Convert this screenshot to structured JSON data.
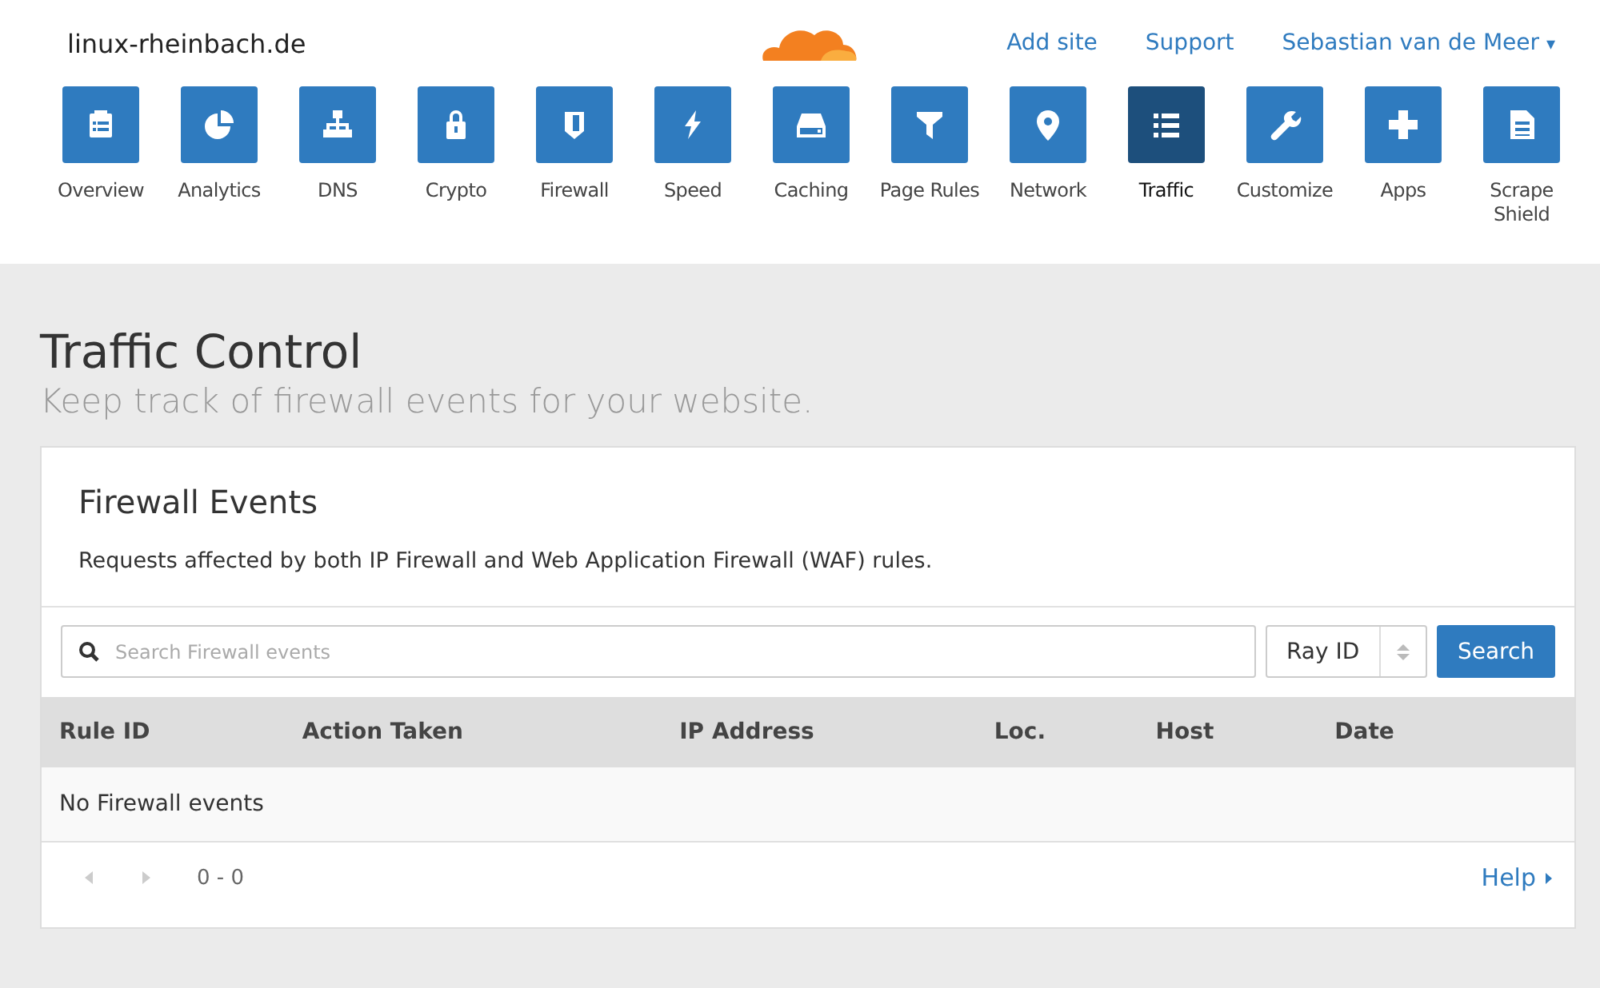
{
  "site": "linux-rheinbach.de",
  "top_links": [
    "Add site",
    "Support"
  ],
  "user_menu": {
    "label": "Sebastian van de Meer",
    "caret": "▾"
  },
  "nav": [
    {
      "label": "Overview",
      "selected": false
    },
    {
      "label": "Analytics",
      "selected": false
    },
    {
      "label": "DNS",
      "selected": false
    },
    {
      "label": "Crypto",
      "selected": false
    },
    {
      "label": "Firewall",
      "selected": false
    },
    {
      "label": "Speed",
      "selected": false
    },
    {
      "label": "Caching",
      "selected": false
    },
    {
      "label": "Page Rules",
      "selected": false
    },
    {
      "label": "Network",
      "selected": false
    },
    {
      "label": "Traffic",
      "selected": true
    },
    {
      "label": "Customize",
      "selected": false
    },
    {
      "label": "Apps",
      "selected": false
    },
    {
      "label": "Scrape Shield",
      "selected": false
    }
  ],
  "page": {
    "title": "Traffic Control",
    "subtitle": "Keep track of firewall events for your website."
  },
  "card": {
    "title": "Firewall Events",
    "description": "Requests affected by both IP Firewall and Web Application Firewall (WAF) rules.",
    "search": {
      "placeholder": "Search Firewall events",
      "select": "Ray ID",
      "button": "Search"
    },
    "table": {
      "columns": [
        "Rule ID",
        "Action Taken",
        "IP Address",
        "Loc.",
        "Host",
        "Date"
      ],
      "empty": "No Firewall events"
    },
    "pagination": {
      "range": "0 - 0"
    },
    "help": "Help"
  }
}
